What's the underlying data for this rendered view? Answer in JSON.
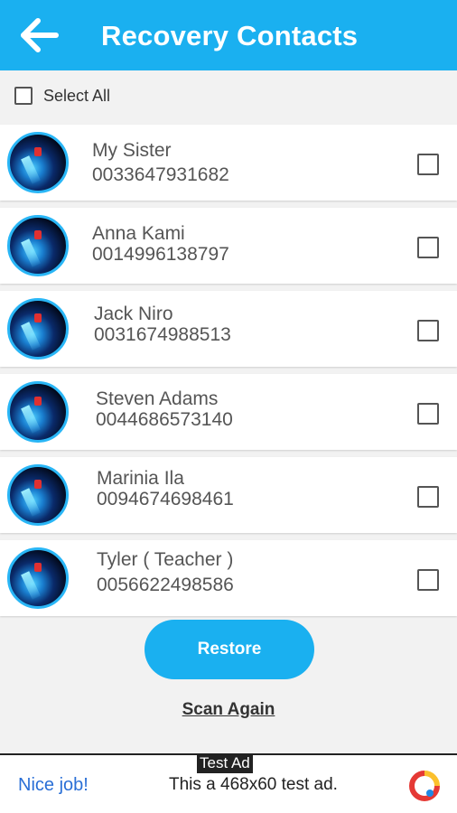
{
  "header": {
    "title": "Recovery Contacts"
  },
  "select_all": {
    "label": "Select All"
  },
  "contacts": [
    {
      "name": "My Sister",
      "phone": "0033647931682"
    },
    {
      "name": "Anna Kami",
      "phone": "0014996138797"
    },
    {
      "name": "Jack Niro",
      "phone": "0031674988513"
    },
    {
      "name": "Steven Adams",
      "phone": "0044686573140"
    },
    {
      "name": "Marinia Ila",
      "phone": "0094674698461"
    },
    {
      "name": "Tyler ( Teacher )",
      "phone": "0056622498586"
    }
  ],
  "actions": {
    "restore": "Restore",
    "scan_again": "Scan Again"
  },
  "ad": {
    "tag": "Test Ad",
    "left_text": "Nice job!",
    "text": "This a 468x60 test ad."
  },
  "colors": {
    "accent": "#1ab0f0",
    "background": "#f2f2f2"
  }
}
